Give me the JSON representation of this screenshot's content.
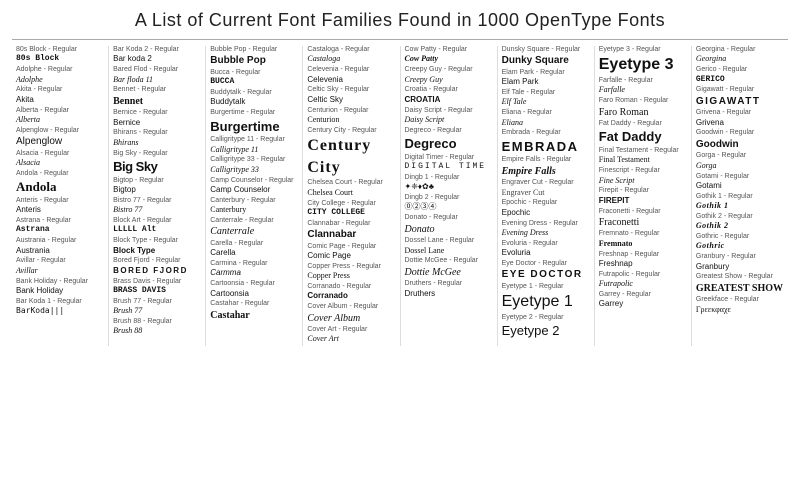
{
  "title": "A List of Current Font Families Found in 1000 OpenType Fonts",
  "columns": [
    {
      "entries": [
        {
          "label": "80s Block - Regular",
          "display": "80s Block",
          "size": "sm",
          "style": "block bold"
        },
        {
          "label": "Adolphe - Regular",
          "display": "Adolphe",
          "size": "sm",
          "style": "script"
        },
        {
          "label": "Akita - Regular",
          "display": "Akita",
          "size": "sm",
          "style": "normal"
        },
        {
          "label": "Alberta - Regular",
          "display": "Alberta",
          "size": "sm",
          "style": "script italic"
        },
        {
          "label": "Alpenglow - Regular",
          "display": "Alpenglow",
          "size": "md",
          "style": "normal"
        },
        {
          "label": "Alsacia - Regular",
          "display": "Alsacia",
          "size": "sm",
          "style": "script"
        },
        {
          "label": "Andola - Regular",
          "display": "Andola",
          "size": "lg",
          "style": "serif bold"
        },
        {
          "label": "Anteris - Regular",
          "display": "Anteris",
          "size": "sm",
          "style": "normal"
        },
        {
          "label": "Astrana - Regular",
          "display": "Astrana",
          "size": "sm",
          "style": "block"
        },
        {
          "label": "Austrania - Regular",
          "display": "Austrania",
          "size": "sm",
          "style": "normal"
        },
        {
          "label": "Avillar - Regular",
          "display": "Avillar",
          "size": "sm",
          "style": "script"
        },
        {
          "label": "Bank Holiday - Regular",
          "display": "Bank Holiday",
          "size": "sm",
          "style": "normal"
        },
        {
          "label": "Bar Koda 1 - Regular",
          "display": "BarKoda|||",
          "size": "sm",
          "style": "barcode"
        }
      ]
    },
    {
      "entries": [
        {
          "label": "Bar Koda 2 - Regular",
          "display": "Bar koda 2",
          "size": "sm",
          "style": "normal"
        },
        {
          "label": "Bared Flod - Regular",
          "display": "Bar floda 11",
          "size": "sm",
          "style": "script"
        },
        {
          "label": "Bennet - Regular",
          "display": "Bennet",
          "size": "md",
          "style": "serif bold"
        },
        {
          "label": "Bernice - Regular",
          "display": "Bernice",
          "size": "sm",
          "style": "normal"
        },
        {
          "label": "Bhirans - Regular",
          "display": "Bhirans",
          "size": "sm",
          "style": "script"
        },
        {
          "label": "Big Sky - Regular",
          "display": "Big Sky",
          "size": "lg",
          "style": "bold condensed"
        },
        {
          "label": "Bigtop - Regular",
          "display": "Bigtop",
          "size": "sm",
          "style": "normal"
        },
        {
          "label": "Bistro 77 - Regular",
          "display": "Bistro 77",
          "size": "sm",
          "style": "script"
        },
        {
          "label": "Block Art - Regular",
          "display": "LLLLL Alt",
          "size": "sm",
          "style": "block"
        },
        {
          "label": "Block Type - Regular",
          "display": "Block Type",
          "size": "sm",
          "style": "bold"
        },
        {
          "label": "Bored Fjord - Regular",
          "display": "BORED FJORD",
          "size": "sm",
          "style": "wide bold"
        },
        {
          "label": "Brass Davis - Regular",
          "display": "BRASS DAVIS",
          "size": "sm",
          "style": "block"
        },
        {
          "label": "Brush 77 - Regular",
          "display": "Brush 77",
          "size": "sm",
          "style": "script"
        },
        {
          "label": "Brush 88 - Regular",
          "display": "Brush 88",
          "size": "sm",
          "style": "script italic"
        }
      ]
    },
    {
      "entries": [
        {
          "label": "Bubble Pop - Regular",
          "display": "Bubble Pop",
          "size": "md",
          "style": "bold"
        },
        {
          "label": "Bucca - Regular",
          "display": "BUCCA",
          "size": "sm",
          "style": "block bold"
        },
        {
          "label": "Buddytalk - Regular",
          "display": "Buddytalk",
          "size": "sm",
          "style": "normal"
        },
        {
          "label": "Burgertime - Regular",
          "display": "Burgertime",
          "size": "lg",
          "style": "bold"
        },
        {
          "label": "Calligritype 11 - Regular",
          "display": "Calligritype 11",
          "size": "sm",
          "style": "script"
        },
        {
          "label": "Calligritype 33 - Regular",
          "display": "Calligritype 33",
          "size": "sm",
          "style": "script"
        },
        {
          "label": "Camp Counselor - Regular",
          "display": "Camp Counselor",
          "size": "sm",
          "style": "normal"
        },
        {
          "label": "Canterbury - Regular",
          "display": "Canterbury",
          "size": "sm",
          "style": "serif"
        },
        {
          "label": "Canterrale - Regular",
          "display": "Canterrale",
          "size": "md",
          "style": "script"
        },
        {
          "label": "Carella - Regular",
          "display": "Carella",
          "size": "sm",
          "style": "normal"
        },
        {
          "label": "Carmina - Regular",
          "display": "Carmma",
          "size": "sm",
          "style": "italic"
        },
        {
          "label": "Cartoonsia - Regular",
          "display": "Cartoonsia",
          "size": "sm",
          "style": "normal"
        },
        {
          "label": "Castahar - Regular",
          "display": "Castahar",
          "size": "md",
          "style": "serif bold"
        }
      ]
    },
    {
      "entries": [
        {
          "label": "Castaloga - Regular",
          "display": "Castaloga",
          "size": "sm",
          "style": "script"
        },
        {
          "label": "Celevenia - Regular",
          "display": "Celevenia",
          "size": "sm",
          "style": "normal"
        },
        {
          "label": "Celtic Sky - Regular",
          "display": "Celtic Sky",
          "size": "sm",
          "style": "normal"
        },
        {
          "label": "Centurion - Regular",
          "display": "Centurion",
          "size": "sm",
          "style": "serif"
        },
        {
          "label": "Century City - Regular",
          "display": "Century City",
          "size": "xl",
          "style": "serif bold wide"
        },
        {
          "label": "Chelsea Court - Regular",
          "display": "Chelsea Court",
          "size": "sm",
          "style": "serif"
        },
        {
          "label": "City College - Regular",
          "display": "CITY COLLEGE",
          "size": "sm",
          "style": "block"
        },
        {
          "label": "Clannabar - Regular",
          "display": "Clannabar",
          "size": "md",
          "style": "bold"
        },
        {
          "label": "Comic Page - Regular",
          "display": "Comic Page",
          "size": "sm",
          "style": "normal"
        },
        {
          "label": "Copper Press - Regular",
          "display": "Copper Press",
          "size": "sm",
          "style": "serif"
        },
        {
          "label": "Corranado - Regular",
          "display": "Corranado",
          "size": "sm",
          "style": "bold"
        },
        {
          "label": "Cover Album - Regular",
          "display": "Cover Album",
          "size": "md",
          "style": "script italic"
        },
        {
          "label": "Cover Art - Regular",
          "display": "Cover Art",
          "size": "sm",
          "style": "script italic"
        }
      ]
    },
    {
      "entries": [
        {
          "label": "Cow Patty - Regular",
          "display": "Cow Patty",
          "size": "sm",
          "style": "script bold"
        },
        {
          "label": "Creepy Guy - Regular",
          "display": "Creepy Guy",
          "size": "sm",
          "style": "script"
        },
        {
          "label": "Croatia - Regular",
          "display": "CROATIA",
          "size": "sm",
          "style": "bold"
        },
        {
          "label": "Daisy Script - Regular",
          "display": "Daisy Script",
          "size": "sm",
          "style": "script"
        },
        {
          "label": "Degreco - Regular",
          "display": "Degreco",
          "size": "lg",
          "style": "bold"
        },
        {
          "label": "Digital Timer - Regular",
          "display": "DIGITAL TIME",
          "size": "sm",
          "style": "digital"
        },
        {
          "label": "Dingb 1 - Regular",
          "display": "✦❈♦✿♣",
          "size": "sm",
          "style": "symbol"
        },
        {
          "label": "Dingb 2 - Regular",
          "display": "⓪➁③④",
          "size": "sm",
          "style": "symbol"
        },
        {
          "label": "Donato - Regular",
          "display": "Donato",
          "size": "md",
          "style": "script"
        },
        {
          "label": "Dossel Lane - Regular",
          "display": "Dossel Lane",
          "size": "sm",
          "style": "serif"
        },
        {
          "label": "Dottie McGee - Regular",
          "display": "Dottie McGee",
          "size": "md",
          "style": "script"
        },
        {
          "label": "Druthers - Regular",
          "display": "Druthers",
          "size": "sm",
          "style": "normal"
        }
      ]
    },
    {
      "entries": [
        {
          "label": "Dunsky Square - Regular",
          "display": "Dunky Square",
          "size": "md",
          "style": "bold sans"
        },
        {
          "label": "Elam Park - Regular",
          "display": "Elam Park",
          "size": "sm",
          "style": "normal"
        },
        {
          "label": "Elf Tale - Regular",
          "display": "Elf Tale",
          "size": "sm",
          "style": "script italic"
        },
        {
          "label": "Eliana - Regular",
          "display": "Eliana",
          "size": "sm",
          "style": "script"
        },
        {
          "label": "Embrada - Regular",
          "display": "EMBRADA",
          "size": "lg",
          "style": "wide bold"
        },
        {
          "label": "Empire Falls - Regular",
          "display": "Empire Falls",
          "size": "md",
          "style": "serif italic bold"
        },
        {
          "label": "Engraver Cut - Regular",
          "display": "Engraver Cut",
          "size": "sm",
          "style": "engraved"
        },
        {
          "label": "Epochic - Regular",
          "display": "Epochic",
          "size": "sm",
          "style": "normal"
        },
        {
          "label": "Evening Dress - Regular",
          "display": "Evening Dress",
          "size": "sm",
          "style": "script italic"
        },
        {
          "label": "Evoluria - Regular",
          "display": "Evoluria",
          "size": "sm",
          "style": "normal"
        },
        {
          "label": "Eye Doctor - Regular",
          "display": "EYE DOCTOR",
          "size": "md",
          "style": "bold wide"
        },
        {
          "label": "Eyetype 1 - Regular",
          "display": "Eyetype 1",
          "size": "xl",
          "style": "normal"
        },
        {
          "label": "Eyetype 2 - Regular",
          "display": "Eyetype 2",
          "size": "lg",
          "style": "normal"
        }
      ]
    },
    {
      "entries": [
        {
          "label": "Eyetype 3 - Regular",
          "display": "Eyetype 3",
          "size": "xl",
          "style": "bold"
        },
        {
          "label": "Farfalle - Regular",
          "display": "Farfalle",
          "size": "sm",
          "style": "script"
        },
        {
          "label": "Faro Roman - Regular",
          "display": "Faro Roman",
          "size": "md",
          "style": "serif"
        },
        {
          "label": "Fat Daddy - Regular",
          "display": "Fat Daddy",
          "size": "lg",
          "style": "bold"
        },
        {
          "label": "Final Testament - Regular",
          "display": "Final Testament",
          "size": "sm",
          "style": "serif"
        },
        {
          "label": "Finescript - Regular",
          "display": "Fine Script",
          "size": "sm",
          "style": "script italic"
        },
        {
          "label": "Firepit - Regular",
          "display": "FIREPIT",
          "size": "sm",
          "style": "bold"
        },
        {
          "label": "Fraconetti - Regular",
          "display": "Fraconetti",
          "size": "md",
          "style": "serif"
        },
        {
          "label": "Fremnato - Regular",
          "display": "Fremnato",
          "size": "sm",
          "style": "bold serif"
        },
        {
          "label": "Freshnap - Regular",
          "display": "Freshnap",
          "size": "sm",
          "style": "normal"
        },
        {
          "label": "Futrapolic - Regular",
          "display": "Futrapolic",
          "size": "sm",
          "style": "script"
        },
        {
          "label": "Garrey - Regular",
          "display": "Garrey",
          "size": "sm",
          "style": "normal"
        }
      ]
    },
    {
      "entries": [
        {
          "label": "Georgina - Regular",
          "display": "Georgina",
          "size": "sm",
          "style": "script"
        },
        {
          "label": "Gerico - Regular",
          "display": "GERICO",
          "size": "sm",
          "style": "block"
        },
        {
          "label": "Gigawatt - Regular",
          "display": "GIGAWATT",
          "size": "md",
          "style": "bold wide"
        },
        {
          "label": "Grivena - Regular",
          "display": "Grivena",
          "size": "sm",
          "style": "normal"
        },
        {
          "label": "Goodwin - Regular",
          "display": "Goodwin",
          "size": "md",
          "style": "bold"
        },
        {
          "label": "Gorga - Regular",
          "display": "Gorga",
          "size": "sm",
          "style": "script"
        },
        {
          "label": "Gotami - Regular",
          "display": "Gotami",
          "size": "sm",
          "style": "normal"
        },
        {
          "label": "Gothik 1 - Regular",
          "display": "Gothik 1",
          "size": "sm",
          "style": "gothic"
        },
        {
          "label": "Gothik 2 - Regular",
          "display": "Gothik 2",
          "size": "sm",
          "style": "gothic"
        },
        {
          "label": "Gothric - Regular",
          "display": "Gothric",
          "size": "sm",
          "style": "gothic"
        },
        {
          "label": "Granbury - Regular",
          "display": "Granbury",
          "size": "sm",
          "style": "normal"
        },
        {
          "label": "Greatest Show - Regular",
          "display": "GREATEST SHOW",
          "size": "md",
          "style": "bold serif"
        },
        {
          "label": "Greekface - Regular",
          "display": "Γρεεκφαχε",
          "size": "sm",
          "style": "greek"
        }
      ]
    }
  ]
}
